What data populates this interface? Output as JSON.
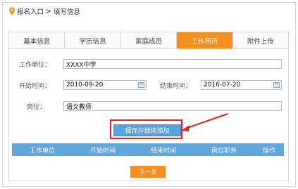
{
  "breadcrumb": {
    "home": "报名入口",
    "separator": ">",
    "current": "填写信息"
  },
  "tabs": [
    {
      "label": "基本信息",
      "active": false
    },
    {
      "label": "学历信息",
      "active": false
    },
    {
      "label": "家庭成员",
      "active": false
    },
    {
      "label": "工作简历",
      "active": true
    },
    {
      "label": "附件上传",
      "active": false
    }
  ],
  "form": {
    "employer_label": "工作单位：",
    "employer_value": "XXXX中学",
    "start_label": "开始时间：",
    "start_value": "2010-09-20",
    "end_label": "结束时间：",
    "end_value": "2016-07-20",
    "position_label": "岗位：",
    "position_value": "语文教师"
  },
  "save_button": "保存并继续添加",
  "table": {
    "headers": [
      "工作单位",
      "开始时间",
      "结束时间",
      "岗位职务",
      "操作"
    ]
  },
  "next_button": "下一步",
  "colors": {
    "accent": "#f58f1f",
    "blue": "#5fa6df",
    "annotation": "#e2241b"
  }
}
